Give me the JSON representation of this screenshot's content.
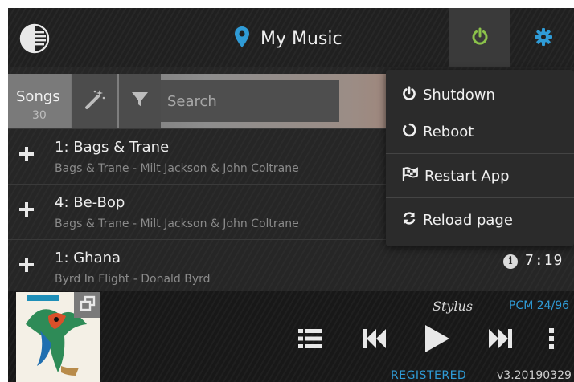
{
  "header": {
    "title": "My Music",
    "logo_icon": "vinyl-logo-icon",
    "location_icon": "location-pin-icon",
    "power_icon": "power-icon",
    "settings_icon": "gear-icon",
    "accent_blue": "#2f9bd6",
    "power_green": "#8bc34a"
  },
  "toolbar": {
    "songs_label": "Songs",
    "songs_count": "30",
    "wand_icon": "magic-wand-icon",
    "filter_icon": "filter-icon",
    "search_placeholder": "Search"
  },
  "songs": [
    {
      "title": "1: Bags & Trane",
      "subtitle": "Bags & Trane - Milt Jackson & John Coltrane"
    },
    {
      "title": "4: Be-Bop",
      "subtitle": "Bags & Trane - Milt Jackson & John Coltrane"
    },
    {
      "title": "1: Ghana",
      "subtitle": "Byrd In Flight - Donald Byrd",
      "duration": "7:19",
      "info_label": "i"
    }
  ],
  "power_menu": {
    "items": [
      {
        "label": "Shutdown",
        "icon": "power-icon"
      },
      {
        "label": "Reboot",
        "icon": "circle-notch-icon"
      },
      {
        "label": "Restart App",
        "icon": "flag-checkered-icon"
      },
      {
        "label": "Reload page",
        "icon": "sync-icon"
      }
    ]
  },
  "player": {
    "brand": "Stylus",
    "format": "PCM 24/96",
    "status": "REGISTERED",
    "version": "v3.20190329",
    "controls": [
      "queue-list-icon",
      "skip-back-icon",
      "play-icon",
      "skip-forward-icon",
      "more-vertical-icon"
    ]
  }
}
